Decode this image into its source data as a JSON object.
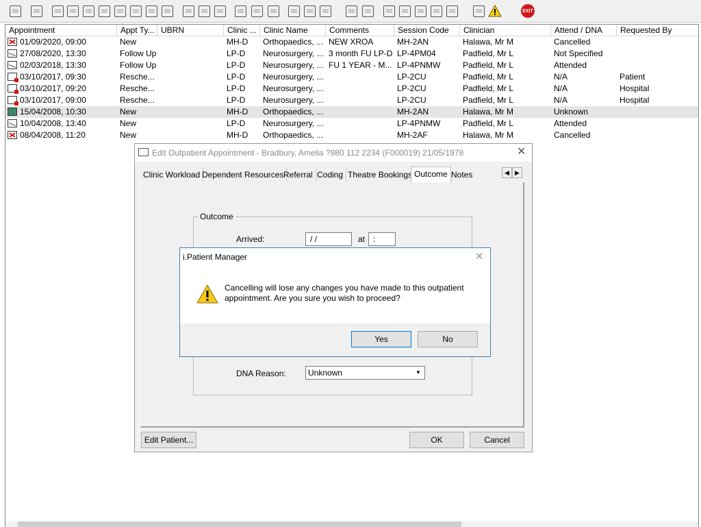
{
  "toolbar": {
    "buttons": [
      {
        "name": "patient-icon"
      },
      {
        "name": "printer-icon"
      },
      {
        "name": "book-icon"
      },
      {
        "name": "edit-note-icon"
      },
      {
        "name": "mail-icon"
      },
      {
        "name": "m-icon"
      },
      {
        "name": "doctor-icon"
      },
      {
        "name": "notes-icon"
      },
      {
        "name": "flag-icon"
      },
      {
        "name": "flag-icon"
      },
      {
        "name": "envelope-cross-icon"
      },
      {
        "name": "clock-icon"
      },
      {
        "name": "list-icon"
      },
      {
        "name": "chart-icon"
      },
      {
        "name": "letter-icon"
      },
      {
        "name": "compass-icon"
      },
      {
        "name": "memo-icon"
      },
      {
        "name": "transport-icon"
      },
      {
        "name": "ambulance-icon"
      },
      {
        "name": "document-icon"
      },
      {
        "name": "bar-chart-icon"
      },
      {
        "name": "globe-icon"
      },
      {
        "name": "forms-icon"
      },
      {
        "name": "form-edit-icon"
      },
      {
        "name": "green-arrow-icon"
      },
      {
        "name": "green-check-icon"
      },
      {
        "name": "swap-icon"
      },
      {
        "name": "warning-icon"
      }
    ],
    "exit_label": "EXIT"
  },
  "grid": {
    "columns": [
      "Appointment",
      "Appt Ty...",
      "UBRN",
      "Clinic ...",
      "Clinic Name",
      "Comments",
      "Session Code",
      "Clinician",
      "Attend / DNA",
      "Requested By"
    ],
    "rows": [
      {
        "icon": "x",
        "appointment": "01/09/2020, 09:00",
        "type": "New",
        "ubrn": "",
        "clinic": "MH-D",
        "clinic_name": "Orthopaedics, ...",
        "comments": "NEW XROA",
        "session": "MH-2AN",
        "clinician": "Halawa, Mr M",
        "attend": "Cancelled",
        "requested": ""
      },
      {
        "icon": "plain",
        "appointment": "27/08/2020, 13:30",
        "type": "Follow Up",
        "ubrn": "",
        "clinic": "LP-D",
        "clinic_name": "Neurosurgery, ...",
        "comments": "3 month FU LP-D",
        "session": "LP-4PM04",
        "clinician": "Padfield, Mr L",
        "attend": "Not Specified",
        "requested": ""
      },
      {
        "icon": "plain",
        "appointment": "02/03/2018, 13:30",
        "type": "Follow Up",
        "ubrn": "",
        "clinic": "LP-D",
        "clinic_name": "Neurosurgery, ...",
        "comments": "FU 1 YEAR - M...",
        "session": "LP-4PNMW",
        "clinician": "Padfield, Mr L",
        "attend": "Attended",
        "requested": ""
      },
      {
        "icon": "res",
        "appointment": "03/10/2017, 09:30",
        "type": "Resche...",
        "ubrn": "",
        "clinic": "LP-D",
        "clinic_name": "Neurosurgery, ...",
        "comments": "",
        "session": "LP-2CU",
        "clinician": "Padfield, Mr L",
        "attend": "N/A",
        "requested": "Patient"
      },
      {
        "icon": "res",
        "appointment": "03/10/2017, 09:20",
        "type": "Resche...",
        "ubrn": "",
        "clinic": "LP-D",
        "clinic_name": "Neurosurgery, ...",
        "comments": "",
        "session": "LP-2CU",
        "clinician": "Padfield, Mr L",
        "attend": "N/A",
        "requested": "Hospital"
      },
      {
        "icon": "res",
        "appointment": "03/10/2017, 09:00",
        "type": "Resche...",
        "ubrn": "",
        "clinic": "LP-D",
        "clinic_name": "Neurosurgery, ...",
        "comments": "",
        "session": "LP-2CU",
        "clinician": "Padfield, Mr L",
        "attend": "N/A",
        "requested": "Hospital"
      },
      {
        "icon": "book",
        "appointment": "15/04/2008, 10:30",
        "type": "New",
        "ubrn": "",
        "clinic": "MH-D",
        "clinic_name": "Orthopaedics, ...",
        "comments": "",
        "session": "MH-2AN",
        "clinician": "Halawa, Mr M",
        "attend": "Unknown",
        "requested": ""
      },
      {
        "icon": "plain",
        "appointment": "10/04/2008, 13:40",
        "type": "New",
        "ubrn": "",
        "clinic": "LP-D",
        "clinic_name": "Neurosurgery, ...",
        "comments": "",
        "session": "LP-4PNMW",
        "clinician": "Padfield, Mr L",
        "attend": "Attended",
        "requested": ""
      },
      {
        "icon": "x",
        "appointment": "08/04/2008, 11:20",
        "type": "New",
        "ubrn": "",
        "clinic": "MH-D",
        "clinic_name": "Orthopaedics, ...",
        "comments": "",
        "session": "MH-2AF",
        "clinician": "Halawa, Mr M",
        "attend": "Cancelled",
        "requested": ""
      }
    ]
  },
  "edit_window": {
    "title": "Edit Outpatient Appointment - Bradbury, Amelia ?980 112 2234 (F000019) 21/05/1978",
    "tabs": [
      "Clinic Workload",
      "Dependent Resources",
      "Referral",
      "Coding",
      "Theatre Bookings",
      "Outcome",
      "Notes"
    ],
    "active_tab": "Outcome",
    "group_title": "Outcome",
    "arrived_label": "Arrived:",
    "arrived_date": "/ /",
    "at_label": "at",
    "arrived_time": ":",
    "dna_reason_label": "DNA Reason:",
    "dna_reason_value": "Unknown",
    "edit_patient_button": "Edit Patient...",
    "ok_button": "OK",
    "cancel_button": "Cancel"
  },
  "message_box": {
    "title": "i.Patient Manager",
    "text": "Cancelling will lose any changes you have made to this outpatient appointment. Are you sure you wish to proceed?",
    "yes_button": "Yes",
    "no_button": "No"
  }
}
